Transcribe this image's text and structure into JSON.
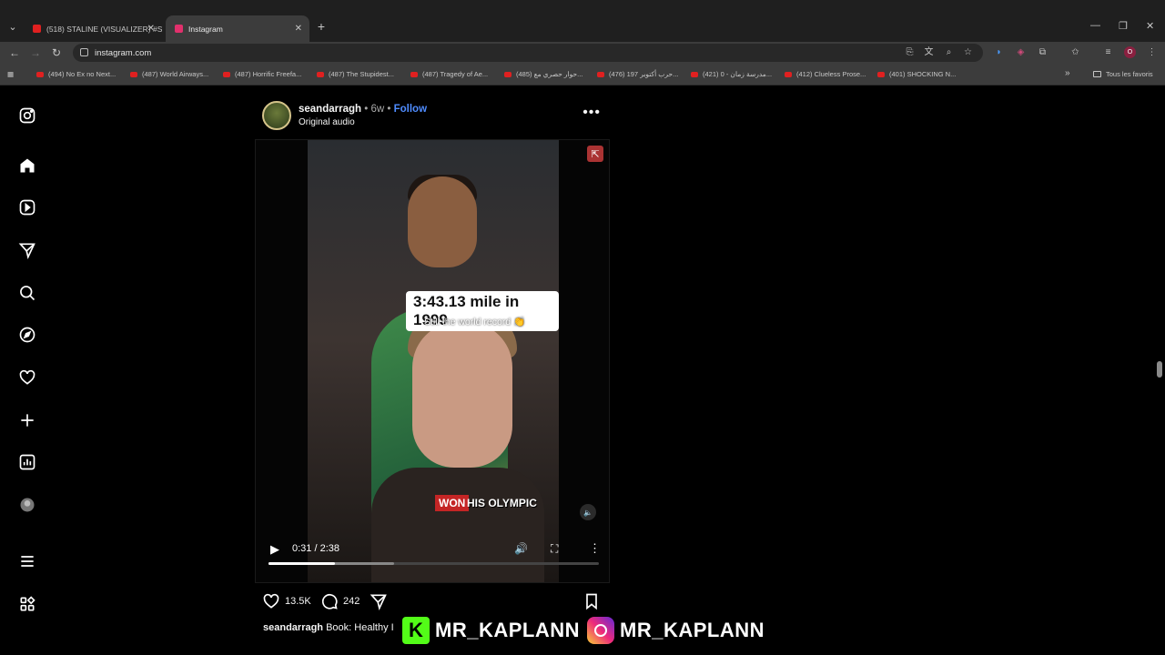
{
  "browser": {
    "tabs": [
      {
        "title": "(518) STALINE (VISUALIZER) #S...",
        "active": false,
        "favicon_color": "#e02020"
      },
      {
        "title": "Instagram",
        "active": true,
        "favicon_color": "#e1306c"
      }
    ],
    "new_tab": "+",
    "url": "instagram.com",
    "bookmarks": [
      "(494) No Ex no Next...",
      "(487) World Airways...",
      "(487) Horrific Freefa...",
      "(487) The Stupidest...",
      "(487) Tragedy of Ae...",
      "(485) حوار حصري مع...",
      "(476) حرب أكتوبر 197...",
      "(421) مدرسة زمان - 0...",
      "(412) Clueless Prose...",
      "(401) SHOCKING N..."
    ],
    "bookmarks_more": "»",
    "all_bookmarks": "Tous les favoris",
    "profile_initial": "O"
  },
  "post": {
    "username": "seandarragh",
    "age": "6w",
    "follow_label": "Follow",
    "audio": "Original audio",
    "more_label": "•••",
    "video": {
      "title_overlay": "3:43.13 mile in 1999",
      "subtitle_overlay": "Still the world record 👏",
      "caption_overlay_red": "WON",
      "caption_overlay_rest": "HIS OLYMPIC",
      "time": "0:31 / 2:38",
      "progress": 0.2,
      "buffered": 0.38
    },
    "likes": "13.5K",
    "comments": "242",
    "caption_user": "seandarragh",
    "caption_text": "Book: Healthy I"
  },
  "overlay": {
    "kick_letter": "K",
    "handle1": "MR_KAPLANN",
    "handle2": "MR_KAPLANN"
  },
  "sidebar_icons": [
    "instagram-logo-icon",
    "home-icon",
    "reels-icon",
    "messages-icon",
    "search-icon",
    "explore-icon",
    "notifications-icon",
    "create-icon",
    "dashboard-icon",
    "profile-avatar",
    "menu-icon",
    "threads-icon"
  ]
}
